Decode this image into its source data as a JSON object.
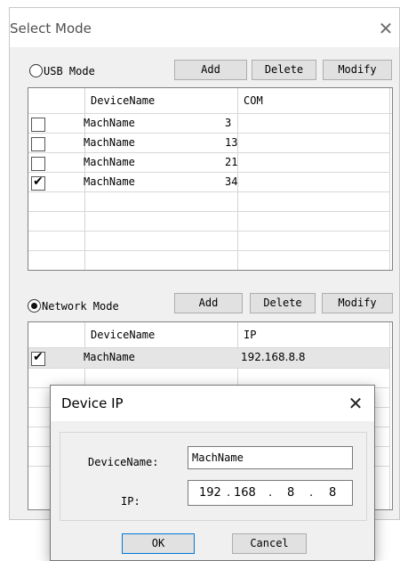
{
  "main_window": {
    "title": "Select Mode",
    "close_glyph": "✕"
  },
  "usb_section": {
    "radio_label": "USB Mode",
    "selected": false,
    "buttons": {
      "add": "Add",
      "delete": "Delete",
      "modify": "Modify"
    },
    "columns": [
      "DeviceName",
      "COM"
    ],
    "rows": [
      {
        "checked": false,
        "device": "MachName",
        "value": "3"
      },
      {
        "checked": false,
        "device": "MachName",
        "value": "13"
      },
      {
        "checked": false,
        "device": "MachName",
        "value": "21"
      },
      {
        "checked": true,
        "device": "MachName",
        "value": "34"
      }
    ]
  },
  "network_section": {
    "radio_label": "Network Mode",
    "selected": true,
    "buttons": {
      "add": "Add",
      "delete": "Delete",
      "modify": "Modify"
    },
    "columns": [
      "DeviceName",
      "IP"
    ],
    "rows": [
      {
        "checked": true,
        "device": "MachName",
        "value": "192.168.8.8"
      }
    ]
  },
  "device_ip_dialog": {
    "title": "Device IP",
    "close_glyph": "✕",
    "device_name_label": "DeviceName:",
    "device_name_value": "MachName",
    "ip_label": "IP:",
    "ip_octets": [
      "192",
      "168",
      "8",
      "8"
    ],
    "ok_label": "OK",
    "cancel_label": "Cancel"
  },
  "colors": {
    "window_bg": "#f0f0f0",
    "title_bg": "#ffffff",
    "selected_row_bg": "#e5e5e5",
    "button_bg": "#e1e1e1"
  }
}
